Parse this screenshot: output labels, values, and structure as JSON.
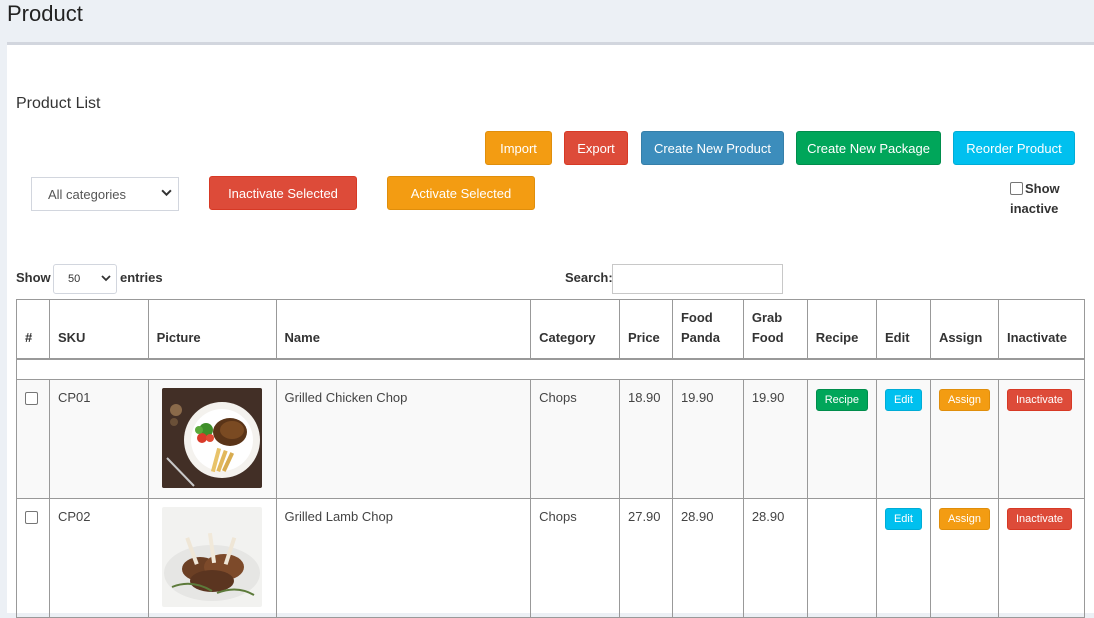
{
  "page": {
    "title": "Product"
  },
  "box": {
    "title": "Product List"
  },
  "toolbar": {
    "import_label": "Import",
    "export_label": "Export",
    "create_product_label": "Create New Product",
    "create_package_label": "Create New Package",
    "reorder_label": "Reorder Product",
    "inactivate_selected_label": "Inactivate Selected",
    "activate_selected_label": "Activate Selected",
    "category_select_value": "All categories",
    "show_inactive_label": "Show inactive"
  },
  "datatable": {
    "show_label": "Show",
    "length_value": "50",
    "entries_label": "entries",
    "search_label": "Search:",
    "search_value": ""
  },
  "table": {
    "headers": {
      "num": "#",
      "sku": "SKU",
      "picture": "Picture",
      "name": "Name",
      "category": "Category",
      "price": "Price",
      "foodpanda_line1": "Food",
      "foodpanda_line2": "Panda",
      "grabfood_line1": "Grab",
      "grabfood_line2": "Food",
      "recipe": "Recipe",
      "edit": "Edit",
      "assign": "Assign",
      "inactivate": "Inactivate"
    },
    "rows": [
      {
        "sku": "CP01",
        "name": "Grilled Chicken Chop",
        "category": "Chops",
        "price": "18.90",
        "foodpanda": "19.90",
        "grabfood": "19.90",
        "recipe_label": "Recipe",
        "edit_label": "Edit",
        "assign_label": "Assign",
        "inactivate_label": "Inactivate"
      },
      {
        "sku": "CP02",
        "name": "Grilled Lamb Chop",
        "category": "Chops",
        "price": "27.90",
        "foodpanda": "28.90",
        "grabfood": "28.90",
        "edit_label": "Edit",
        "assign_label": "Assign",
        "inactivate_label": "Inactivate"
      }
    ]
  }
}
